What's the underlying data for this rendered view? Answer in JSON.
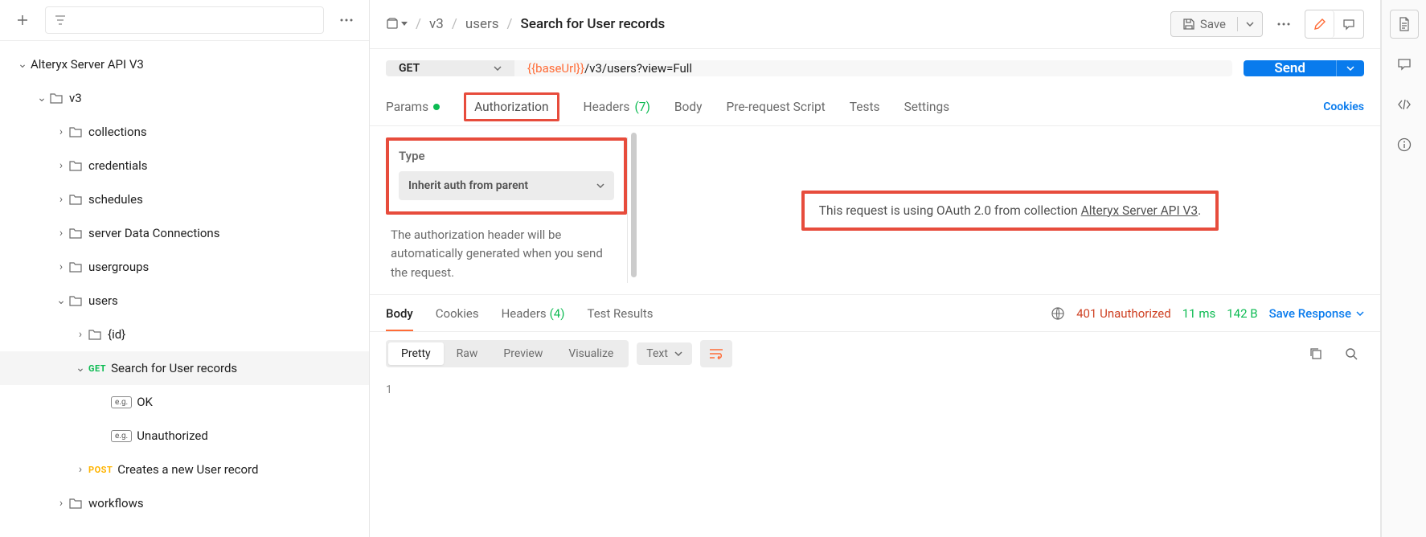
{
  "sidebar": {
    "root": "Alteryx Server API V3",
    "v3": "v3",
    "items": {
      "collections": "collections",
      "credentials": "credentials",
      "schedules": "schedules",
      "serverDataConnections": "server Data Connections",
      "usergroups": "usergroups",
      "users": "users",
      "workflows": "workflows",
      "id": "{id}",
      "searchUsers": "Search for User records",
      "ok": "OK",
      "unauthorized": "Unauthorized",
      "createUser": "Creates a new User record"
    },
    "methods": {
      "get": "GET",
      "post": "POST",
      "eg": "e.g."
    }
  },
  "header": {
    "crumbs": {
      "v3": "v3",
      "users": "users",
      "current": "Search for User records"
    },
    "save": "Save"
  },
  "request": {
    "method": "GET",
    "url_var": "{{baseUrl}}",
    "url_path": "/v3/users?view=Full",
    "send": "Send",
    "tabs": {
      "params": "Params",
      "authorization": "Authorization",
      "headers": "Headers",
      "headers_count": "(7)",
      "body": "Body",
      "prerequest": "Pre-request Script",
      "tests": "Tests",
      "settings": "Settings",
      "cookies": "Cookies"
    }
  },
  "auth": {
    "type_label": "Type",
    "selected": "Inherit auth from parent",
    "description": "The authorization header will be automatically generated when you send the request.",
    "info_prefix": "This request is using OAuth 2.0 from collection ",
    "info_collection": "Alteryx Server API V3",
    "info_suffix": "."
  },
  "response": {
    "tabs": {
      "body": "Body",
      "cookies": "Cookies",
      "headers": "Headers",
      "headers_count": "(4)",
      "testResults": "Test Results"
    },
    "status_code": "401 Unauthorized",
    "time": "11 ms",
    "size": "142 B",
    "save": "Save Response",
    "views": {
      "pretty": "Pretty",
      "raw": "Raw",
      "preview": "Preview",
      "visualize": "Visualize"
    },
    "lang": "Text",
    "line1": "1"
  }
}
